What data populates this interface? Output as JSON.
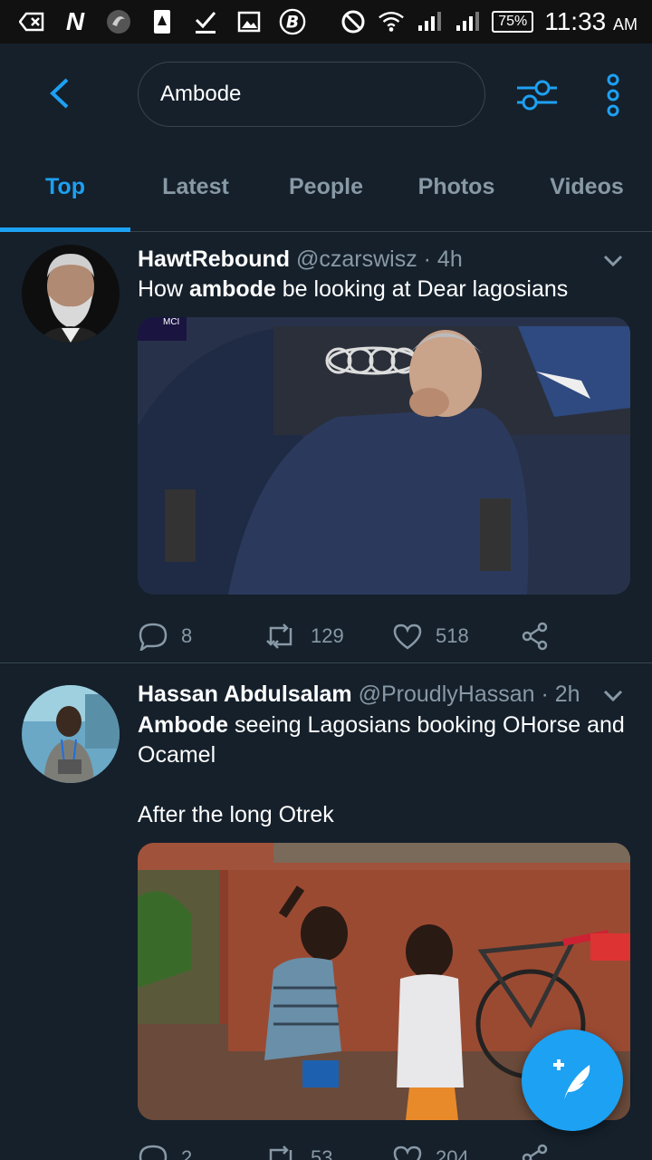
{
  "status_bar": {
    "battery": "75%",
    "time": "11:33",
    "ampm": "AM"
  },
  "search": {
    "query": "Ambode"
  },
  "tabs": [
    {
      "label": "Top",
      "active": true
    },
    {
      "label": "Latest"
    },
    {
      "label": "People"
    },
    {
      "label": "Photos"
    },
    {
      "label": "Videos"
    }
  ],
  "tweets": [
    {
      "name": "HawtRebound",
      "handle": "@czarswisz · 4h",
      "text_pre": "How ",
      "text_bold": "ambode",
      "text_post": " be looking at Dear lagosians",
      "media_badge": "MCI",
      "replies": "8",
      "retweets": "129",
      "likes": "518"
    },
    {
      "name": "Hassan Abdulsalam",
      "handle": "@ProudlyHassan · 2h",
      "text_bold": "Ambode",
      "text_line1_post": " seeing Lagosians booking OHorse and",
      "text_line2": "Ocamel",
      "text_line3": "After the long Otrek",
      "replies": "2",
      "retweets": "53",
      "likes": "204"
    }
  ],
  "colors": {
    "accent": "#1da1f2",
    "background": "#15202b",
    "muted": "#8899a6",
    "divider": "#38444d"
  }
}
